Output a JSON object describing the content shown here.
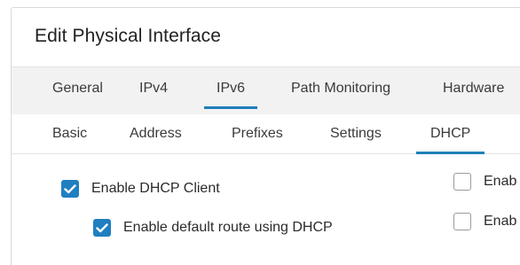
{
  "dialog": {
    "title": "Edit Physical Interface"
  },
  "tabs": [
    {
      "label": "General",
      "active": false
    },
    {
      "label": "IPv4",
      "active": false
    },
    {
      "label": "IPv6",
      "active": true
    },
    {
      "label": "Path Monitoring",
      "active": false
    },
    {
      "label": "Hardware",
      "active": false
    }
  ],
  "subtabs": [
    {
      "label": "Basic",
      "active": false
    },
    {
      "label": "Address",
      "active": false
    },
    {
      "label": "Prefixes",
      "active": false
    },
    {
      "label": "Settings",
      "active": false
    },
    {
      "label": "DHCP",
      "active": true
    }
  ],
  "dhcp": {
    "enable_client": {
      "label": "Enable DHCP Client",
      "checked": true
    },
    "enable_default_route": {
      "label": "Enable default route using DHCP",
      "checked": true
    },
    "right_option_1": {
      "label": "Enab",
      "checked": false
    },
    "right_option_2": {
      "label": "Enab",
      "checked": false
    }
  },
  "colors": {
    "accent": "#1f7fc0",
    "tabbar_bg": "#f2f2f2"
  }
}
